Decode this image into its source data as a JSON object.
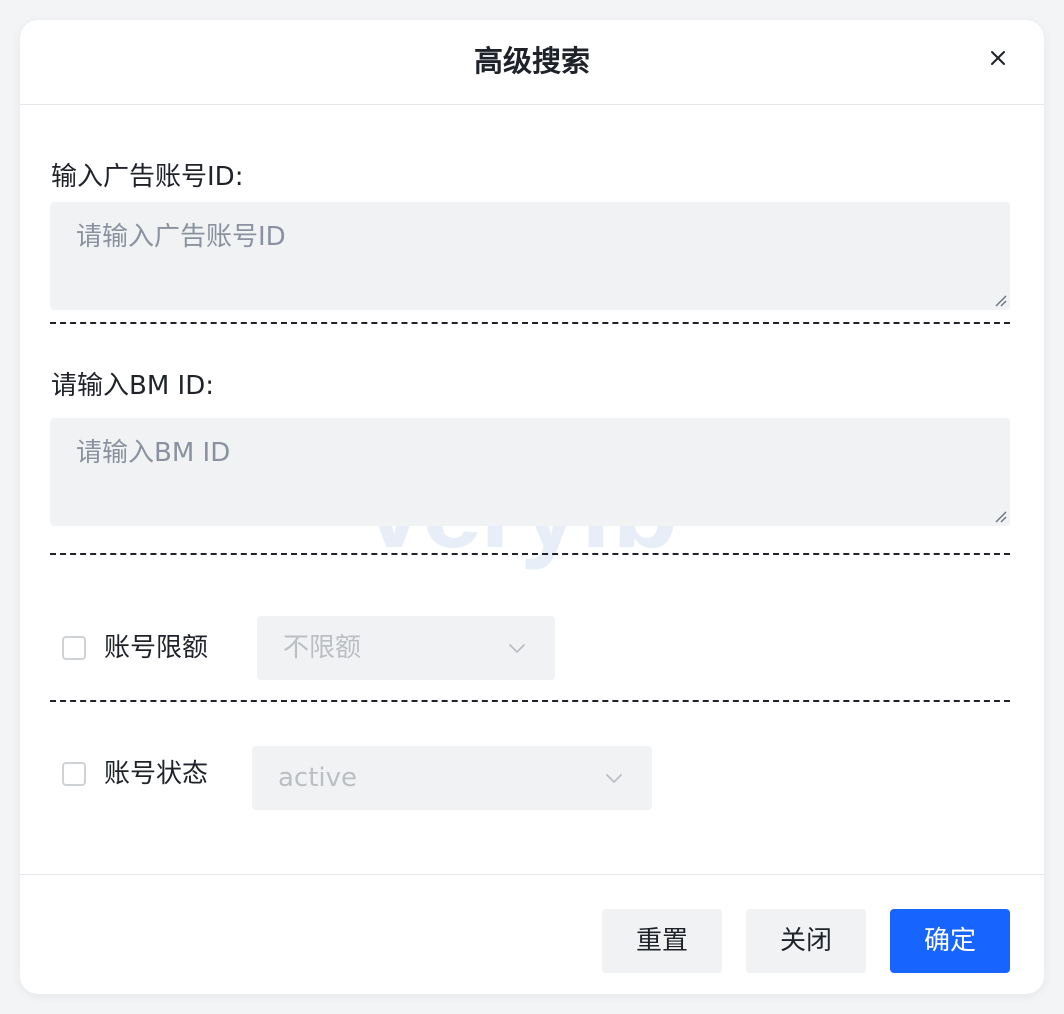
{
  "dialog": {
    "title": "高级搜索",
    "close_icon": "close-icon"
  },
  "fields": {
    "ad_account": {
      "label": "输入广告账号ID:",
      "placeholder": "请输入广告账号ID",
      "value": ""
    },
    "bm": {
      "label": "请输入BM ID:",
      "placeholder": "请输入BM ID",
      "value": ""
    }
  },
  "filters": {
    "limit": {
      "label": "账号限额",
      "checked": false,
      "selected": "不限额"
    },
    "status": {
      "label": "账号状态",
      "checked": false,
      "selected": "active"
    }
  },
  "watermark": "Veryfb",
  "footer": {
    "reset_label": "重置",
    "close_label": "关闭",
    "confirm_label": "确定"
  },
  "colors": {
    "primary": "#1764ff",
    "input_bg": "#f1f2f4",
    "text": "#1f2329",
    "placeholder": "#8a919f"
  }
}
